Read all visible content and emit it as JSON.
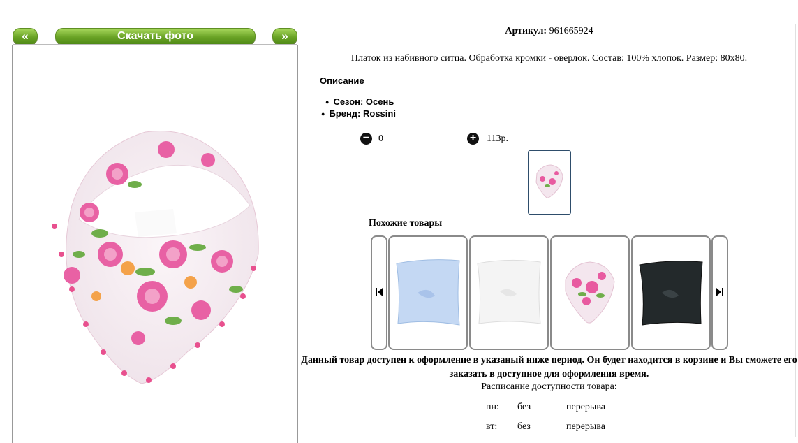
{
  "gallery": {
    "prev_label": "«",
    "download_label": "Скачать фото",
    "next_label": "»"
  },
  "product": {
    "article_label": "Артикул:",
    "article_value": "961665924",
    "description": "Платок из набивного ситца. Обработка кромки - оверлок. Состав: 100% хлопок. Размер: 80x80.",
    "section_title": "Описание",
    "properties": [
      "Сезон: Осень",
      "Бренд: Rossini"
    ],
    "quantity": "0",
    "price": "113р."
  },
  "similar": {
    "title": "Похожие товары",
    "items": [
      {
        "name": "blue-scarf",
        "color": "#c4d8f3"
      },
      {
        "name": "white-scarf",
        "color": "#f4f4f4"
      },
      {
        "name": "floral-scarf",
        "color": "#f2e2ea"
      },
      {
        "name": "black-scarf",
        "color": "#23292b"
      }
    ]
  },
  "availability": {
    "notice": "Данный товар доступен к оформление в указаный ниже период. Он будет находится в корзине и Вы сможете его заказать в доступное для оформления время.",
    "schedule_title": "Расписание доступности товара:",
    "rows": [
      {
        "day": "пн:",
        "from": "без",
        "to": "перерыва"
      },
      {
        "day": "вт:",
        "from": "без",
        "to": "перерыва"
      }
    ]
  },
  "colors": {
    "button_green": "#6aa326",
    "border_gray": "#8a8a8a"
  }
}
